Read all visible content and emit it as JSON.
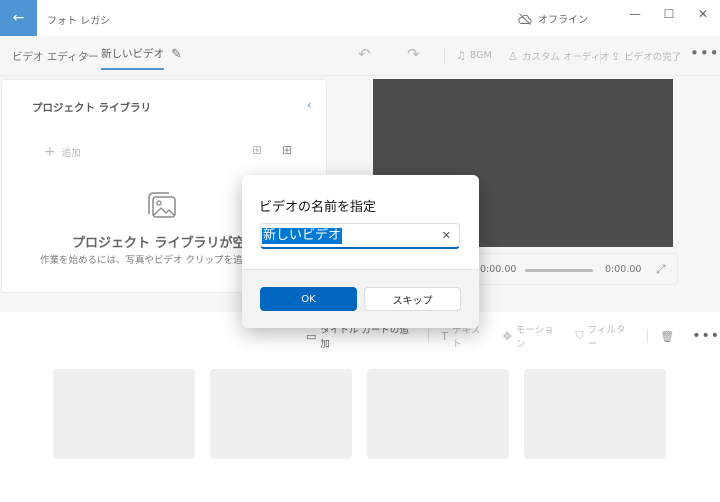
{
  "window": {
    "title": "フォト レガシ",
    "offline_label": "オフライン",
    "back_icon": "arrow-left-icon"
  },
  "toolbar": {
    "breadcrumb_root": "ビデオ エディター",
    "breadcrumb_current": "新しいビデオ",
    "bgm_label": "BGM",
    "custom_audio_label": "カスタム オーディオ",
    "finish_label": "ビデオの完了"
  },
  "library": {
    "title": "プロジェクト ライブラリ",
    "add_label": "追加",
    "empty_title": "プロジェクト ライブラリが空です",
    "empty_subtitle": "作業を始めるには、写真やビデオ クリップを追加してください"
  },
  "player": {
    "current_time": "0:00.00",
    "end_time": "0:00.00"
  },
  "storyboard": {
    "title_card_label": "タイトル カードの追加",
    "text_label": "テキスト",
    "motion_label": "モーション",
    "filter_label": "フィルター"
  },
  "dialog": {
    "title": "ビデオの名前を指定",
    "input_value": "新しいビデオ",
    "ok_label": "OK",
    "skip_label": "スキップ"
  },
  "colors": {
    "accent": "#0067c0",
    "selection": "#0078d4",
    "preview_bg": "#000000"
  }
}
